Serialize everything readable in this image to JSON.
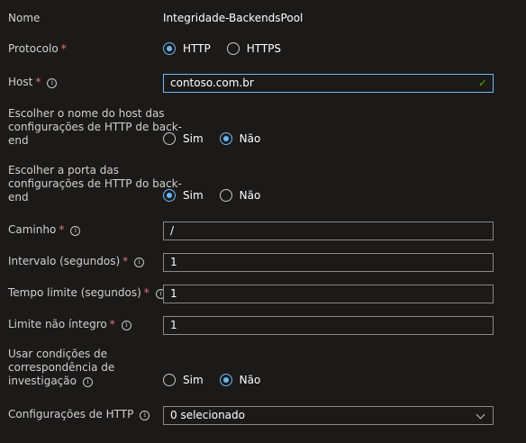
{
  "name": {
    "label": "Nome",
    "value": "Integridade-BackendsPool"
  },
  "protocol": {
    "label": "Protocolo",
    "required": "*",
    "options": [
      "HTTP",
      "HTTPS"
    ],
    "selected": "HTTP"
  },
  "host": {
    "label": "Host",
    "required": "*",
    "value": "contoso.com.br"
  },
  "pick_host": {
    "label_lines": [
      "Escolher o nome do host das",
      "configurações de HTTP de back-",
      "end"
    ],
    "options": [
      "Sim",
      "Não"
    ],
    "selected": "Não"
  },
  "pick_port": {
    "label_lines": [
      "Escolher a porta das",
      "configurações de HTTP do back-",
      "end"
    ],
    "options": [
      "Sim",
      "Não"
    ],
    "selected": "Sim"
  },
  "path": {
    "label": "Caminho",
    "required": "*",
    "value": "/"
  },
  "interval": {
    "label": "Intervalo (segundos)",
    "required": "*",
    "value": "1"
  },
  "timeout": {
    "label": "Tempo limite (segundos)",
    "required": "*",
    "value": "1"
  },
  "unhealthy": {
    "label": "Limite não íntegro",
    "required": "*",
    "value": "1"
  },
  "match": {
    "label_lines": [
      "Usar condições de",
      "correspondência de",
      "investigação"
    ],
    "options": [
      "Sim",
      "Não"
    ],
    "selected": "Não"
  },
  "http_settings": {
    "label": "Configurações de HTTP",
    "value": "0 selecionado"
  },
  "colors": {
    "accent": "#6cb8f6",
    "required": "#f1707b",
    "valid": "#57a300",
    "background": "#1b1a19"
  },
  "icons": {
    "info": "info-icon",
    "check": "checkmark-icon",
    "dropdown": "chevron-down-icon"
  }
}
